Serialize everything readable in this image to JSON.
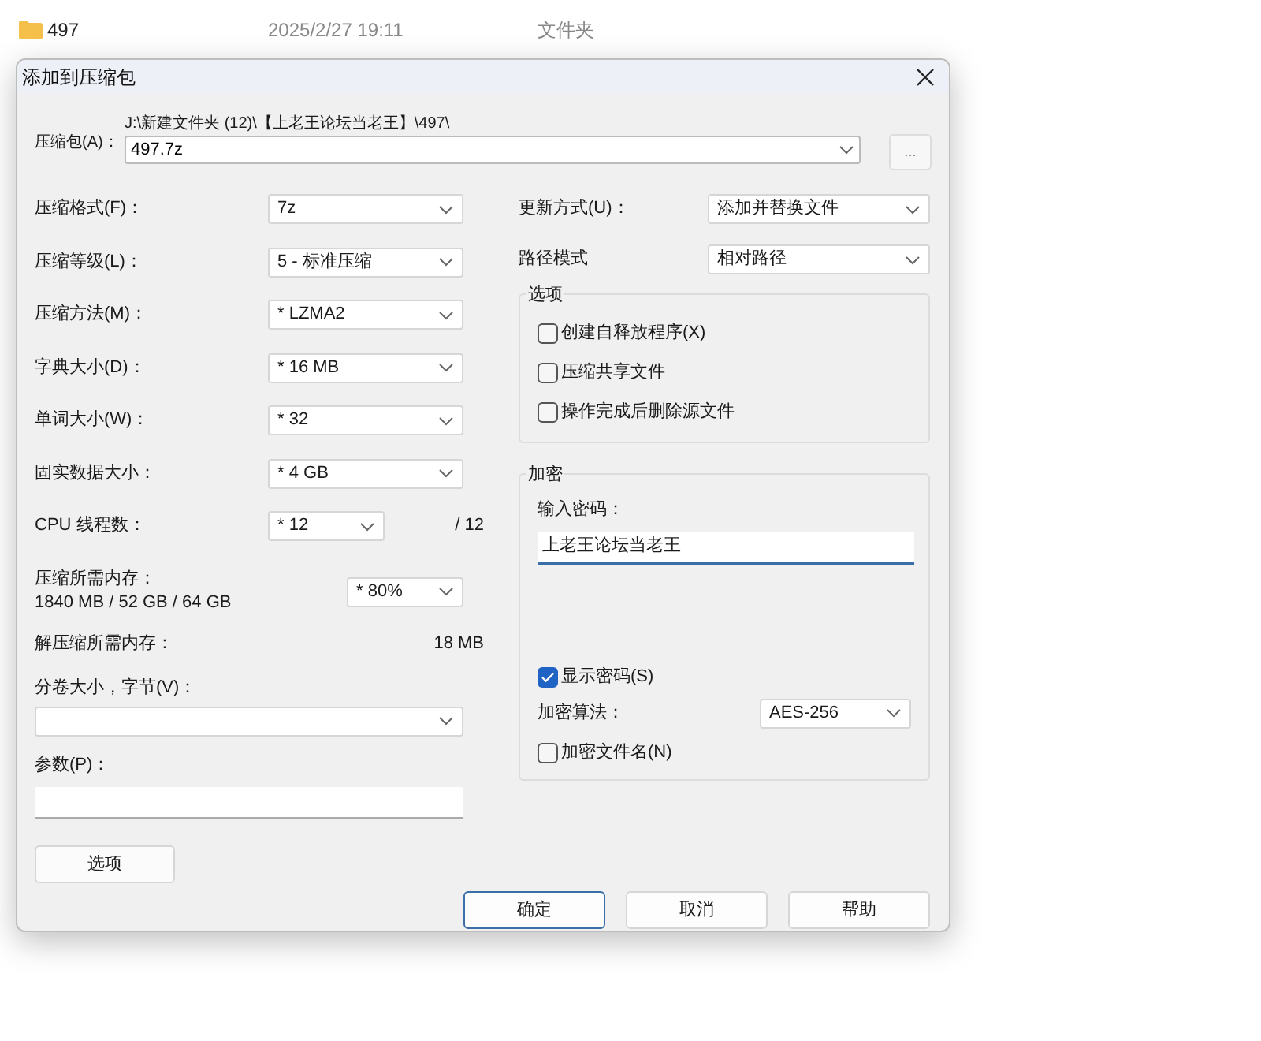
{
  "background_row": {
    "name": "497",
    "date": "2025/2/27 19:11",
    "type": "文件夹"
  },
  "window": {
    "title": "添加到压缩包"
  },
  "archive": {
    "label": "压缩包(A)：",
    "path": "J:\\新建文件夹 (12)\\【上老王论坛当老王】\\497\\",
    "value": "497.7z",
    "browse": "..."
  },
  "left_fields": [
    {
      "kind": "select",
      "label": "压缩格式(F)：",
      "value": "7z"
    },
    {
      "kind": "select",
      "label": "压缩等级(L)：",
      "value": "5 - 标准压缩"
    },
    {
      "kind": "select",
      "label": "压缩方法(M)：",
      "value": "* LZMA2"
    },
    {
      "kind": "select",
      "label": "字典大小(D)：",
      "value": "* 16 MB"
    },
    {
      "kind": "select",
      "label": "单词大小(W)：",
      "value": "* 32"
    },
    {
      "kind": "select",
      "label": "固实数据大小：",
      "value": "* 4 GB"
    },
    {
      "kind": "threads",
      "label": "CPU 线程数：",
      "value": "* 12",
      "suffix": "/ 12"
    },
    {
      "kind": "memory",
      "label": "压缩所需内存：",
      "detail": "1840 MB / 52 GB / 64 GB",
      "value": "* 80%"
    },
    {
      "kind": "info",
      "label": "解压缩所需内存：",
      "value": "18 MB"
    }
  ],
  "volume": {
    "label": "分卷大小，字节(V)："
  },
  "params": {
    "label": "参数(P)："
  },
  "options_button": "选项",
  "right_fields": [
    {
      "label": "更新方式(U)：",
      "value": "添加并替换文件"
    },
    {
      "label": "路径模式",
      "value": "相对路径"
    }
  ],
  "options_group": {
    "title": "选项",
    "items": [
      {
        "label": "创建自释放程序(X)",
        "checked": false
      },
      {
        "label": "压缩共享文件",
        "checked": false
      },
      {
        "label": "操作完成后删除源文件",
        "checked": false
      }
    ]
  },
  "encryption": {
    "title": "加密",
    "password_label": "输入密码：",
    "password": "上老王论坛当老王",
    "show_password": {
      "label": "显示密码(S)",
      "checked": true
    },
    "method_label": "加密算法：",
    "method": "AES-256",
    "encrypt_names": {
      "label": "加密文件名(N)",
      "checked": false
    }
  },
  "buttons": [
    {
      "label": "确定",
      "default": true
    },
    {
      "label": "取消",
      "default": false
    },
    {
      "label": "帮助",
      "default": false
    }
  ]
}
